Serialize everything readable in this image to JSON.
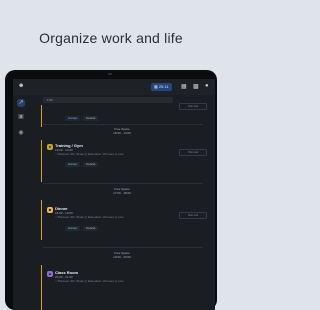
{
  "headline": "Organize work and life",
  "topbar": {
    "avatar_icon": "person-add-icon",
    "date_label": "▦ 25.11",
    "icons": [
      "grid-icon",
      "calendar-icon",
      "user-icon"
    ]
  },
  "filter": {
    "label": "▾ All"
  },
  "rail": [
    "timeline-icon",
    "folder-icon",
    "settings-icon"
  ],
  "tasks": [
    {
      "title": "",
      "time": "",
      "meta": "",
      "accept": "Accept",
      "cancel": "Cancel",
      "note": "Hide task"
    },
    {
      "title": "Training / Gym",
      "time": "13:00 - 14:00",
      "meta": "○ Planned, 9th, Show ◎ Extended, 19 times ◎ Low",
      "accept": "Accept",
      "cancel": "Cancel",
      "note": "Hide task",
      "free": "Free Space",
      "free_time": "18:30 - 14:00",
      "icon_color": "#c9a227"
    },
    {
      "title": "Dinner",
      "time": "18:00 - 19:00",
      "meta": "○ Planned, 9th, Show ◎ Extended, 19 times ◎ Low",
      "accept": "Accept",
      "cancel": "Cancel",
      "note": "Hide task",
      "free": "Free Space",
      "free_time": "17:00 - 18:00",
      "icon_color": "#e8b84a"
    },
    {
      "title": "Class Room",
      "time": "20:00 - 21:00",
      "meta": "○ Planned, 9th, Show ◎ Extended, 19 times ◎ Low",
      "free": "Free Space",
      "free_time": "19:00 - 20:00",
      "icon_color": "#8a6fd1"
    }
  ]
}
